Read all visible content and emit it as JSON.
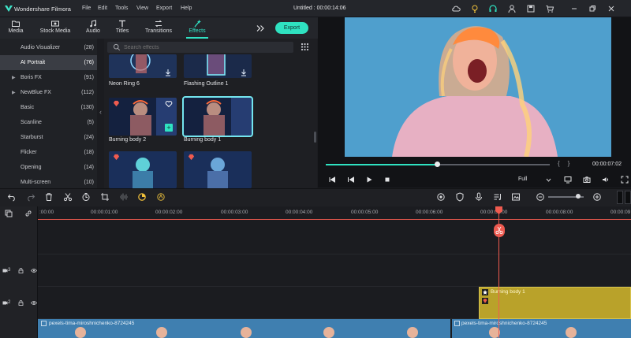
{
  "app": {
    "name": "Wondershare Filmora",
    "document_title": "Untitled : 00:00:14:06"
  },
  "menu": [
    "File",
    "Edit",
    "Tools",
    "View",
    "Export",
    "Help"
  ],
  "tabs": [
    {
      "label": "Media",
      "icon": "folder-icon"
    },
    {
      "label": "Stock Media",
      "icon": "stock-media-icon"
    },
    {
      "label": "Audio",
      "icon": "music-note-icon"
    },
    {
      "label": "Titles",
      "icon": "text-icon"
    },
    {
      "label": "Transitions",
      "icon": "transitions-icon"
    },
    {
      "label": "Effects",
      "icon": "effects-icon",
      "active": true
    }
  ],
  "export_label": "Export",
  "categories": [
    {
      "name": "Audio Visualizer",
      "count": "(28)"
    },
    {
      "name": "AI Portrait",
      "count": "(76)",
      "active": true
    },
    {
      "name": "Boris FX",
      "count": "(91)",
      "expandable": true
    },
    {
      "name": "NewBlue FX",
      "count": "(112)",
      "expandable": true
    },
    {
      "name": "Basic",
      "count": "(130)"
    },
    {
      "name": "Scanline",
      "count": "(5)"
    },
    {
      "name": "Starburst",
      "count": "(24)"
    },
    {
      "name": "Flicker",
      "count": "(18)"
    },
    {
      "name": "Opening",
      "count": "(14)"
    },
    {
      "name": "Multi-screen",
      "count": "(10)"
    }
  ],
  "search": {
    "placeholder": "Search effects"
  },
  "effects": [
    {
      "name": "Neon Ring 6"
    },
    {
      "name": "Flashing Outline 1"
    },
    {
      "name": "Burning body 2"
    },
    {
      "name": "Burning body 1",
      "selected": true
    },
    {
      "name": ""
    },
    {
      "name": ""
    }
  ],
  "preview": {
    "time": "00:00:07:02",
    "quality": "Full",
    "progress": 0.5
  },
  "ruler_labels": [
    ":00:00",
    "00:00:01:00",
    "00:00:02:00",
    "00:00:03:00",
    "00:00:04:00",
    "00:00:05:00",
    "00:00:06:00",
    "00:00:07:00",
    "00:00:08:00",
    "00:00:09"
  ],
  "tracks": [
    {
      "number": "3"
    },
    {
      "number": "2"
    }
  ],
  "effect_clip_label": "Burning body 1",
  "video_clip_label": "pexels-tima-miroshnichenko-8724245",
  "colors": {
    "accent": "#2fe2c1",
    "playhead": "#ef5b4f",
    "effect_clip": "#b9a22a",
    "video_clip": "#3f7fb0",
    "selection": "#74e6ef"
  }
}
